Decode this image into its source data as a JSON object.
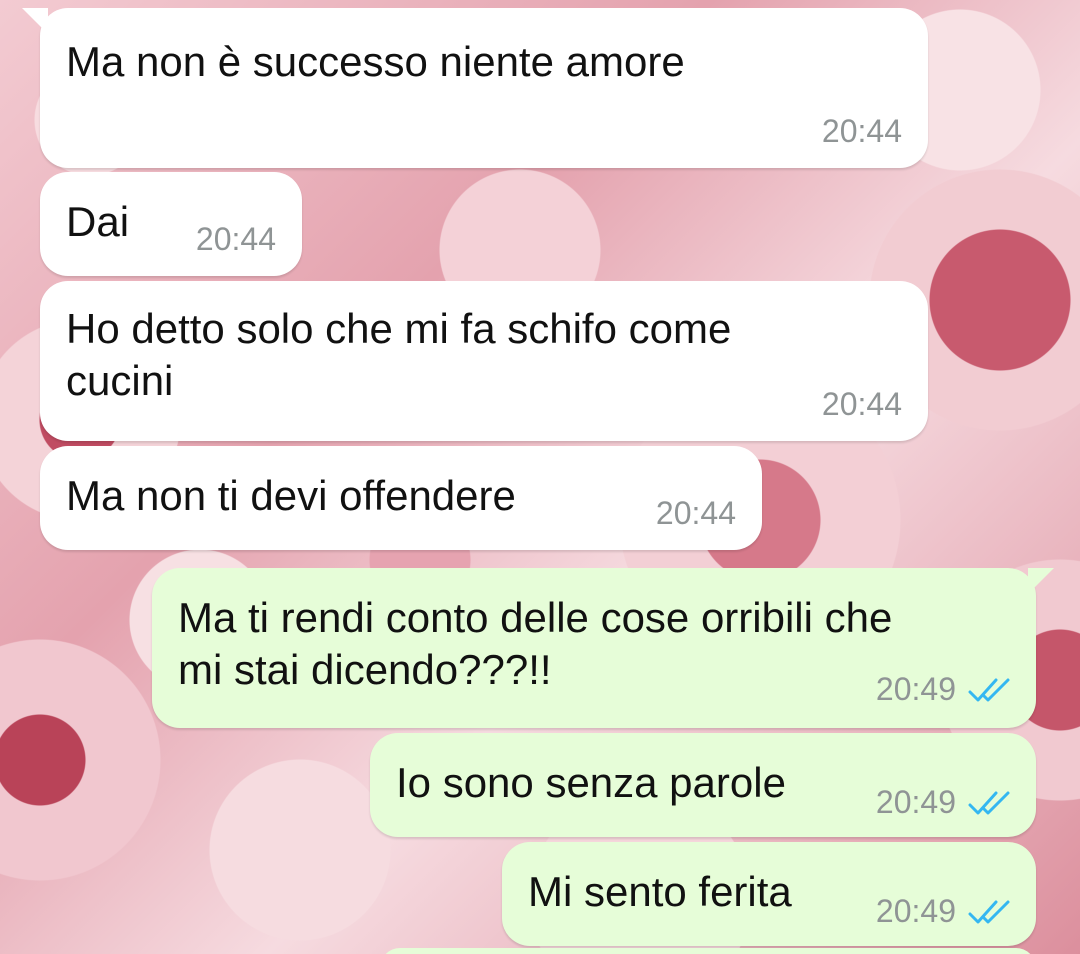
{
  "messages": [
    {
      "direction": "in",
      "text": "Ma non è successo niente amore",
      "time": "20:44"
    },
    {
      "direction": "in",
      "text": "Dai",
      "time": "20:44"
    },
    {
      "direction": "in",
      "text": "Ho detto solo che mi fa schifo come\ncucini",
      "time": "20:44"
    },
    {
      "direction": "in",
      "text": "Ma non ti devi offendere",
      "time": "20:44"
    },
    {
      "direction": "out",
      "text": "Ma ti rendi conto delle cose orribili che\nmi stai dicendo???!!",
      "time": "20:49",
      "status": "read-double-check-icon"
    },
    {
      "direction": "out",
      "text": "Io sono senza parole",
      "time": "20:49",
      "status": "read-double-check-icon"
    },
    {
      "direction": "out",
      "text": "Mi sento ferita",
      "time": "20:49",
      "status": "read-double-check-icon"
    }
  ],
  "colors": {
    "incoming_bubble": "#ffffff",
    "outgoing_bubble": "#e6fdd8",
    "read_ticks": "#34b7f1",
    "timestamp": "#8f9495"
  }
}
